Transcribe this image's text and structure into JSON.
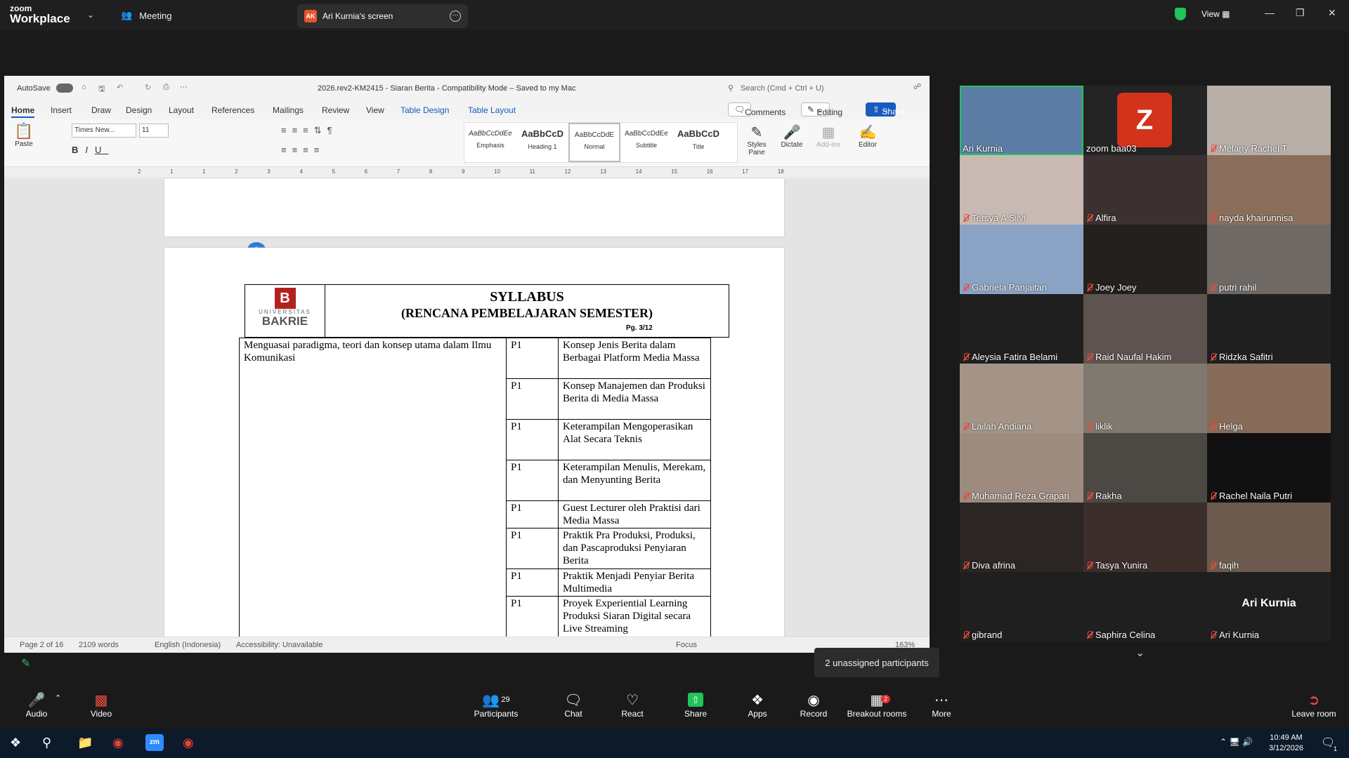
{
  "app": {
    "logo_line1": "zoom",
    "logo_line2": "Workplace",
    "meeting_label": "Meeting",
    "share_tab_initials": "AK",
    "share_tab_label": "Ari Kurnia's screen",
    "view_label": "View"
  },
  "word": {
    "autosave": "AutoSave",
    "doc_title": "2026.rev2-KM2415 - Siaran Berita  -  Compatibility Mode  –  Saved to my Mac",
    "search_placeholder": "Search (Cmd + Ctrl + U)",
    "tabs": [
      "Home",
      "Insert",
      "Draw",
      "Design",
      "Layout",
      "References",
      "Mailings",
      "Review",
      "View",
      "Table Design",
      "Table Layout"
    ],
    "comments_label": "Comments",
    "editing_label": "Editing",
    "share_label": "Share",
    "paste_label": "Paste",
    "font_name": "Times New...",
    "font_size": "11",
    "styles": [
      {
        "preview": "AaBbCcDdEe",
        "name": "Emphasis"
      },
      {
        "preview": "AaBbCcD",
        "name": "Heading 1"
      },
      {
        "preview": "AaBbCcDdE",
        "name": "Normal"
      },
      {
        "preview": "AaBbCcDdEe",
        "name": "Subtitle"
      },
      {
        "preview": "AaBbCcD",
        "name": "Title"
      }
    ],
    "styles_pane": "Styles Pane",
    "dictate": "Dictate",
    "addins": "Add-ins",
    "editor": "Editor",
    "ruler_ticks": [
      "2",
      "1",
      "1",
      "2",
      "3",
      "4",
      "5",
      "6",
      "7",
      "8",
      "9",
      "10",
      "11",
      "12",
      "13",
      "14",
      "15",
      "16",
      "17",
      "18"
    ],
    "status": {
      "page": "Page 2 of 16",
      "words": "2109 words",
      "language": "English (Indonesia)",
      "accessibility": "Accessibility: Unavailable",
      "focus": "Focus",
      "zoom": "163%"
    }
  },
  "syllabus": {
    "univ_small": "UNIVERSITAS",
    "univ_big": "BAKRIE",
    "title": "SYLLABUS",
    "subtitle": "(RENCANA PEMBELAJARAN SEMESTER)",
    "page": "Pg. 3/12",
    "left_cell": "Menguasai  paradigma, teori dan konsep utama dalam Ilmu Komunikasi",
    "rows": [
      {
        "code": "P1",
        "topic": "Konsep Jenis Berita dalam Berbagai Platform Media Massa"
      },
      {
        "code": "P1",
        "topic": "Konsep Manajemen dan Produksi Berita di Media Massa"
      },
      {
        "code": "P1",
        "topic": "Keterampilan Mengoperasikan Alat Secara Teknis"
      },
      {
        "code": "P1",
        "topic": "Keterampilan Menulis, Merekam, dan Menyunting Berita"
      },
      {
        "code": "P1",
        "topic": "Guest Lecturer oleh Praktisi dari Media Massa"
      },
      {
        "code": "P1",
        "topic": "Praktik Pra Produksi, Produksi, dan Pascaproduksi Penyiaran Berita"
      },
      {
        "code": "P1",
        "topic": "Praktik Menjadi Penyiar Berita Multimedia"
      },
      {
        "code": "P1",
        "topic": "Proyek Experiential Learning Produksi Siaran Digital secara Live Streaming"
      }
    ]
  },
  "participants": [
    {
      "name": "Ari Kurnia",
      "bg": "#5c7da3",
      "muted": false
    },
    {
      "name": "zoom baa03",
      "bg": "#242424",
      "muted": false,
      "avatar": "Z"
    },
    {
      "name": "Melany Rachel T",
      "bg": "#b8b0a8",
      "muted": true
    },
    {
      "name": "Tersya A Silvi",
      "bg": "#c9b9b3",
      "muted": true
    },
    {
      "name": "Alfira",
      "bg": "#3a3130",
      "muted": true
    },
    {
      "name": "nayda khairunnisa",
      "bg": "#8a6e5c",
      "muted": true
    },
    {
      "name": "Gabriela Panjaitan",
      "bg": "#8aa3c4",
      "muted": true
    },
    {
      "name": "Joey Joey",
      "bg": "#23201e",
      "muted": true
    },
    {
      "name": "putri rahil",
      "bg": "#6f6965",
      "muted": true
    },
    {
      "name": "Aleysia Fatira Belami",
      "bg": "#1f1f1f",
      "muted": true
    },
    {
      "name": "Raid Naufal Hakim",
      "bg": "#5e5350",
      "muted": true
    },
    {
      "name": "Ridzka Safitri",
      "bg": "#1f1f1f",
      "muted": true
    },
    {
      "name": "Lailah Andiana",
      "bg": "#a39487",
      "muted": true
    },
    {
      "name": "liklik",
      "bg": "#80796f",
      "muted": true
    },
    {
      "name": "Helga",
      "bg": "#866c58",
      "muted": true
    },
    {
      "name": "Muhamad Reza Grapari",
      "bg": "#9d8b80",
      "muted": true
    },
    {
      "name": "Rakha",
      "bg": "#4c4944",
      "muted": true
    },
    {
      "name": "Rachel Naila Putri",
      "bg": "#111111",
      "muted": true
    },
    {
      "name": "Diva afrina",
      "bg": "#2b2523",
      "muted": true
    },
    {
      "name": "Tasya Yunira",
      "bg": "#3b2e2a",
      "muted": true
    },
    {
      "name": "faqih",
      "bg": "#6b5a4d",
      "muted": true
    },
    {
      "name": "gibrand",
      "bg": "#1f1f1f",
      "muted": true
    },
    {
      "name": "Saphira Celina",
      "bg": "#1f1f1f",
      "muted": true
    },
    {
      "name": "Ari Kurnia",
      "bg": "#1f1f1f",
      "muted": true,
      "big_name": "Ari Kurnia"
    }
  ],
  "tooltip": "2 unassigned participants",
  "toolbar": {
    "audio": "Audio",
    "video": "Video",
    "participants": "Participants",
    "participants_count": "29",
    "chat": "Chat",
    "react": "React",
    "share": "Share",
    "apps": "Apps",
    "record": "Record",
    "breakout": "Breakout rooms",
    "breakout_badge": "2",
    "more": "More",
    "leave": "Leave room"
  },
  "taskbar": {
    "time": "10:49 AM",
    "date": "3/12/2026",
    "notif": "1"
  },
  "colors": {
    "accent": "#0e71eb",
    "share_green": "#21c35b",
    "muted_red": "#e74c3c",
    "word_blue": "#185abd"
  }
}
